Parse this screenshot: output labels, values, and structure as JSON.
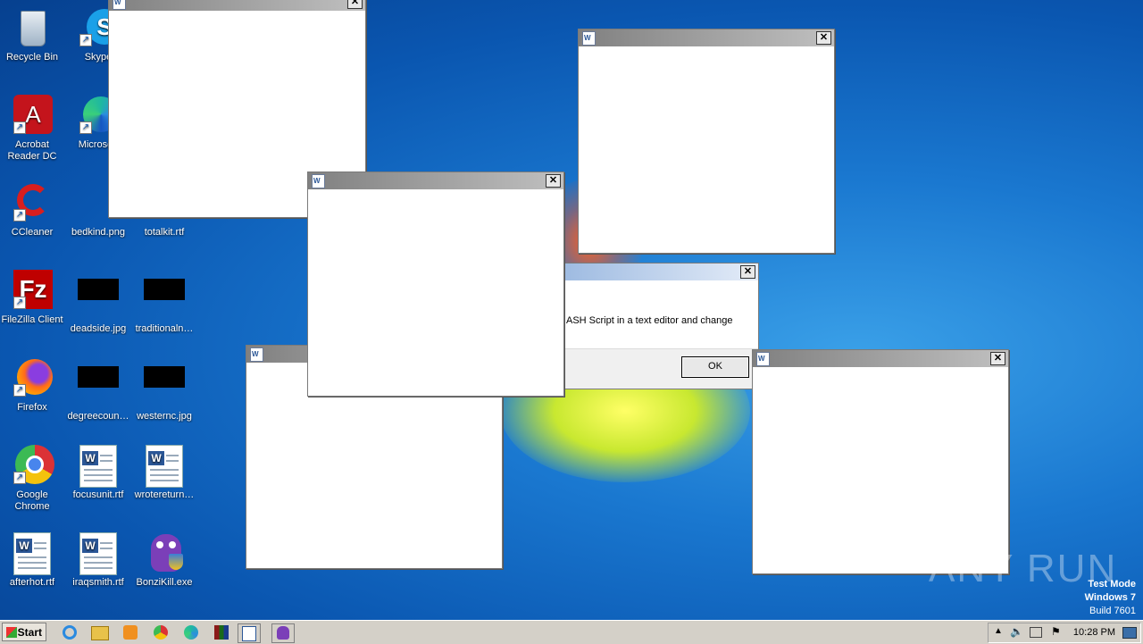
{
  "desktop": {
    "icons": [
      {
        "label": "Recycle Bin",
        "icon": "recycle-bin-icon"
      },
      {
        "label": "Skype",
        "icon": "skype-icon"
      },
      {
        "label": "Acrobat Reader DC",
        "icon": "acrobat-icon"
      },
      {
        "label": "Microsoft",
        "icon": "edge-icon"
      },
      {
        "label": "CCleaner",
        "icon": "ccleaner-icon"
      },
      {
        "label": "bedkind.png",
        "icon": "image-file-icon"
      },
      {
        "label": "totalkit.rtf",
        "icon": "rtf-file-icon"
      },
      {
        "label": "FileZilla Client",
        "icon": "filezilla-icon"
      },
      {
        "label": "deadside.jpg",
        "icon": "image-file-icon"
      },
      {
        "label": "traditionaln…",
        "icon": "image-file-icon"
      },
      {
        "label": "Firefox",
        "icon": "firefox-icon"
      },
      {
        "label": "degreecoun…",
        "icon": "image-file-icon"
      },
      {
        "label": "westernc.jpg",
        "icon": "image-file-icon"
      },
      {
        "label": "Google Chrome",
        "icon": "chrome-icon"
      },
      {
        "label": "focusunit.rtf",
        "icon": "word-doc-icon"
      },
      {
        "label": "wrotereturn…",
        "icon": "word-doc-icon"
      },
      {
        "label": "afterhot.rtf",
        "icon": "word-doc-icon"
      },
      {
        "label": "iraqsmith.rtf",
        "icon": "word-doc-icon"
      },
      {
        "label": "BonziKill.exe",
        "icon": "bonzi-icon"
      }
    ]
  },
  "dialog": {
    "message": "ASH Script in a text editor and change",
    "ok_label": "OK",
    "close_glyph": "✕"
  },
  "close_glyph": "✕",
  "taskbar": {
    "start_label": "Start",
    "clock": "10:28 PM",
    "pinned": [
      "ie-icon",
      "explorer-icon",
      "media-player-icon",
      "chrome-icon",
      "edge-icon",
      "winrar-icon",
      "word-icon",
      "bonzi-icon"
    ]
  },
  "watermark": {
    "brand": "ANY RUN",
    "mode": "Test Mode",
    "os": "Windows 7",
    "build": "Build 7601"
  },
  "colors": {
    "desktop": "#1a78d0",
    "taskbar": "#d4d0c8",
    "titlebar_inactive": "#808080",
    "dialog_title": "#9ab8e0"
  }
}
